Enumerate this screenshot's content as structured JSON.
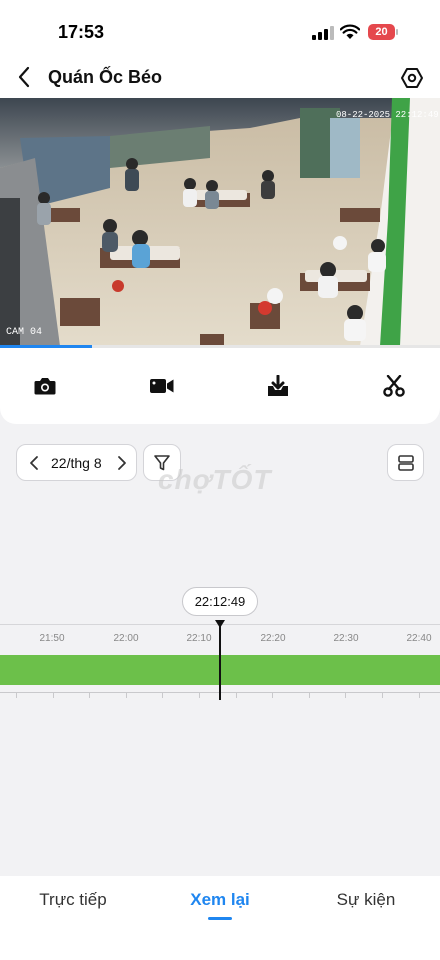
{
  "status_bar": {
    "time": "17:53",
    "battery_level": "20",
    "icons": [
      "signal-icon",
      "wifi-icon",
      "battery-icon"
    ]
  },
  "header": {
    "title": "Quán Ốc Béo",
    "back_icon": "chevron-left-icon",
    "settings_icon": "hexagon-settings-icon"
  },
  "video": {
    "camera_label": "CAM 04",
    "overlay_timestamp": "08-22-2025 22:12:49",
    "progress_fraction": 0.21
  },
  "toolbar": {
    "buttons": [
      "camera-icon",
      "video-camera-icon",
      "download-icon",
      "scissors-icon"
    ]
  },
  "controls": {
    "date_label": "22/thg 8",
    "prev_icon": "chevron-left-icon",
    "next_icon": "chevron-right-icon",
    "filter_icon": "filter-icon",
    "layout_icon": "layout-grid-icon"
  },
  "watermark": "chợTỐT",
  "timeline": {
    "current_time": "22:12:49",
    "tick_labels": [
      "21:50",
      "22:00",
      "22:10",
      "22:20",
      "22:30",
      "22:40"
    ],
    "recording_color": "#6cc04a"
  },
  "tabs": {
    "items": [
      {
        "label": "Trực tiếp",
        "active": false
      },
      {
        "label": "Xem lại",
        "active": true
      },
      {
        "label": "Sự kiện",
        "active": false
      }
    ],
    "accent_color": "#1f86f0"
  }
}
